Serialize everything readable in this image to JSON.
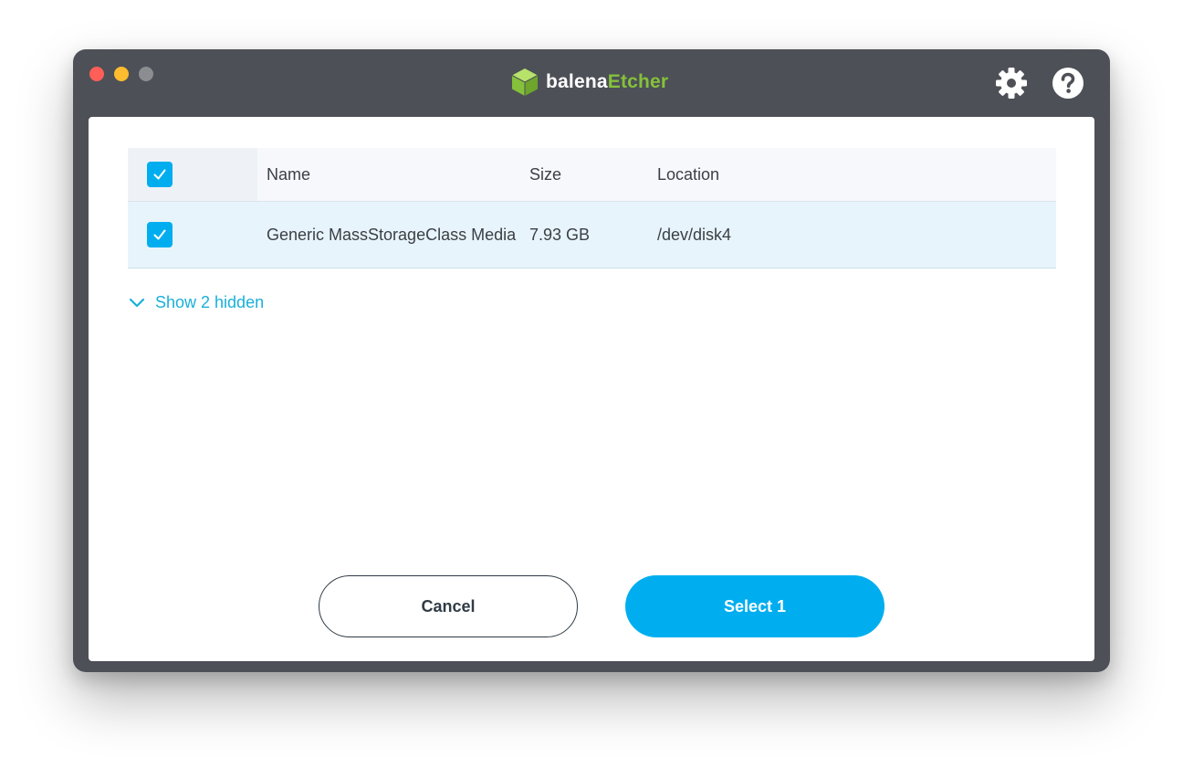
{
  "app": {
    "brand_prefix": "balena",
    "brand_suffix": "Etcher",
    "brand_color": "#85c13a"
  },
  "header": {
    "icons": [
      "gear-icon",
      "help-icon"
    ]
  },
  "table": {
    "columns": {
      "name": "Name",
      "size": "Size",
      "location": "Location"
    },
    "header_checked": true,
    "rows": [
      {
        "name": "Generic MassStorageClass Media",
        "size": "7.93 GB",
        "location": "/dev/disk4",
        "checked": true
      }
    ]
  },
  "show_hidden_label": "Show 2 hidden",
  "buttons": {
    "cancel_label": "Cancel",
    "select_label": "Select 1"
  },
  "colors": {
    "accent": "#00aeef",
    "link": "#1ab0d8",
    "titlebar": "#4d5057"
  }
}
